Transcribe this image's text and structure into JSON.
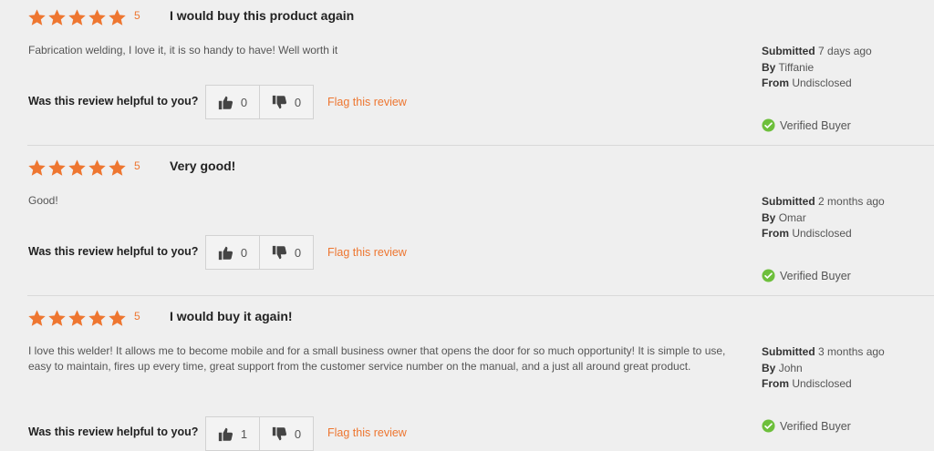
{
  "reviews": [
    {
      "rating": 5,
      "rating_label": "5",
      "title": "I would buy this product again",
      "body": "Fabrication welding, I love it, it is so handy to have! Well worth it",
      "helpful_prompt": "Was this review helpful to you?",
      "helpful_yes": "0",
      "helpful_no": "0",
      "flag_label": "Flag this review",
      "submitted_label": "Submitted",
      "submitted_value": "7 days ago",
      "by_label": "By",
      "author": "Tiffanie",
      "from_label": "From",
      "location": "Undisclosed",
      "verified_label": "Verified Buyer"
    },
    {
      "rating": 5,
      "rating_label": "5",
      "title": "Very good!",
      "body": "Good!",
      "helpful_prompt": "Was this review helpful to you?",
      "helpful_yes": "0",
      "helpful_no": "0",
      "flag_label": "Flag this review",
      "submitted_label": "Submitted",
      "submitted_value": "2 months ago",
      "by_label": "By",
      "author": "Omar",
      "from_label": "From",
      "location": "Undisclosed",
      "verified_label": "Verified Buyer"
    },
    {
      "rating": 5,
      "rating_label": "5",
      "title": "I would buy it again!",
      "body": "I love this welder! It allows me to become mobile and for a small business owner that opens the door for so much opportunity! It is simple to use, easy to maintain, fires up every time, great support from the customer service number on the manual, and a just all around great product.",
      "helpful_prompt": "Was this review helpful to you?",
      "helpful_yes": "1",
      "helpful_no": "0",
      "flag_label": "Flag this review",
      "submitted_label": "Submitted",
      "submitted_value": "3 months ago",
      "by_label": "By",
      "author": "John",
      "from_label": "From",
      "location": "Undisclosed",
      "verified_label": "Verified Buyer"
    }
  ],
  "colors": {
    "star": "#ee7630",
    "flag_link": "#ee7630",
    "verified_check": "#6dbf3b"
  },
  "icons": {
    "star": "star-icon",
    "thumbs_up": "thumbs-up-icon",
    "thumbs_down": "thumbs-down-icon",
    "verified": "check-circle-icon"
  }
}
